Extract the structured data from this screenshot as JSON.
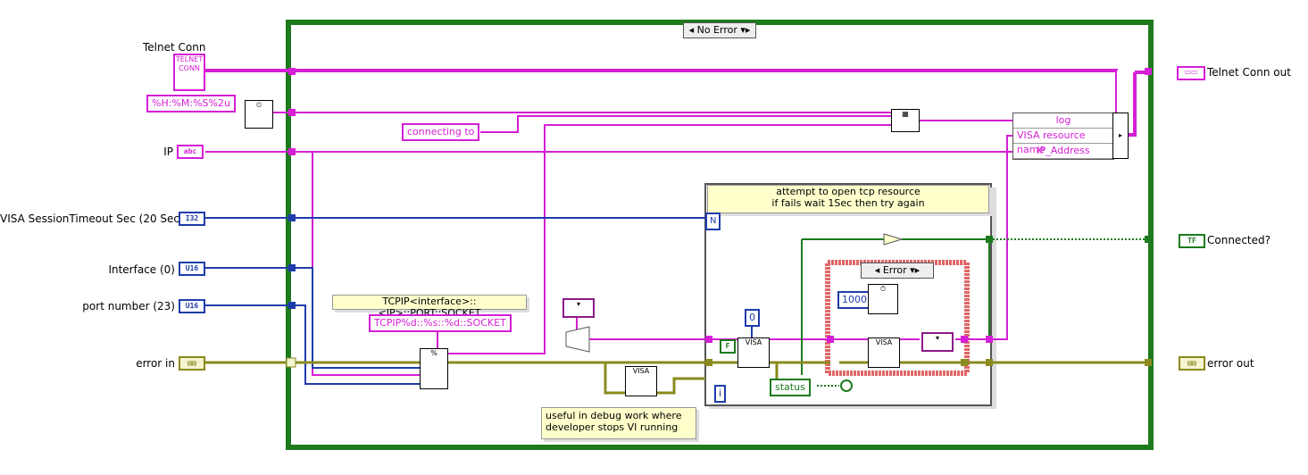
{
  "case_structure": {
    "selector": "No Error"
  },
  "inner_case": {
    "selector": "Error"
  },
  "controls": {
    "telnet_conn": "Telnet Conn",
    "ip": "IP",
    "visa_timeout": "VISA SessionTimeout Sec (20 Sec)",
    "interface": "Interface (0)",
    "port_number": "port number (23)",
    "error_in": "error in"
  },
  "indicators": {
    "telnet_conn_out": "Telnet Conn out",
    "connected": "Connected?",
    "error_out": "error out"
  },
  "terminal_tags": {
    "telnet": "TELNET\nCONN",
    "ip": "abc",
    "timeout": "I32",
    "interface": "U16",
    "port": "U16",
    "connected": "TF"
  },
  "constants": {
    "time_format": "%H:%M:%S%2u",
    "connecting_to": "connecting to",
    "resource_format_label": "TCPIP<interface>::<IP>::PORT::SOCKET",
    "resource_format": "TCPIP%d::%s::%d::SOCKET",
    "wait_ms": "1000",
    "visa_zero": "0",
    "false_const": "F",
    "loop_iter": "i",
    "stop_terminal": "N"
  },
  "bundle": {
    "fields": [
      "log",
      "VISA resource name",
      "IP_Address"
    ]
  },
  "comments": {
    "loop_note_line1": "attempt to open tcp resource",
    "loop_note_line2": "if fails wait 1Sec then try again",
    "debug_note_line1": "useful in debug work  where",
    "debug_note_line2": "developer stops VI running"
  },
  "status_label": "status",
  "colors": {
    "string_wire": "#d51ed5",
    "numeric_wire": "#1f3cab",
    "boolean_wire": "#1d7a1d",
    "error_wire": "#8a8a1e",
    "structure_border": "#1d7a1d",
    "error_case_border": "#e06666"
  }
}
